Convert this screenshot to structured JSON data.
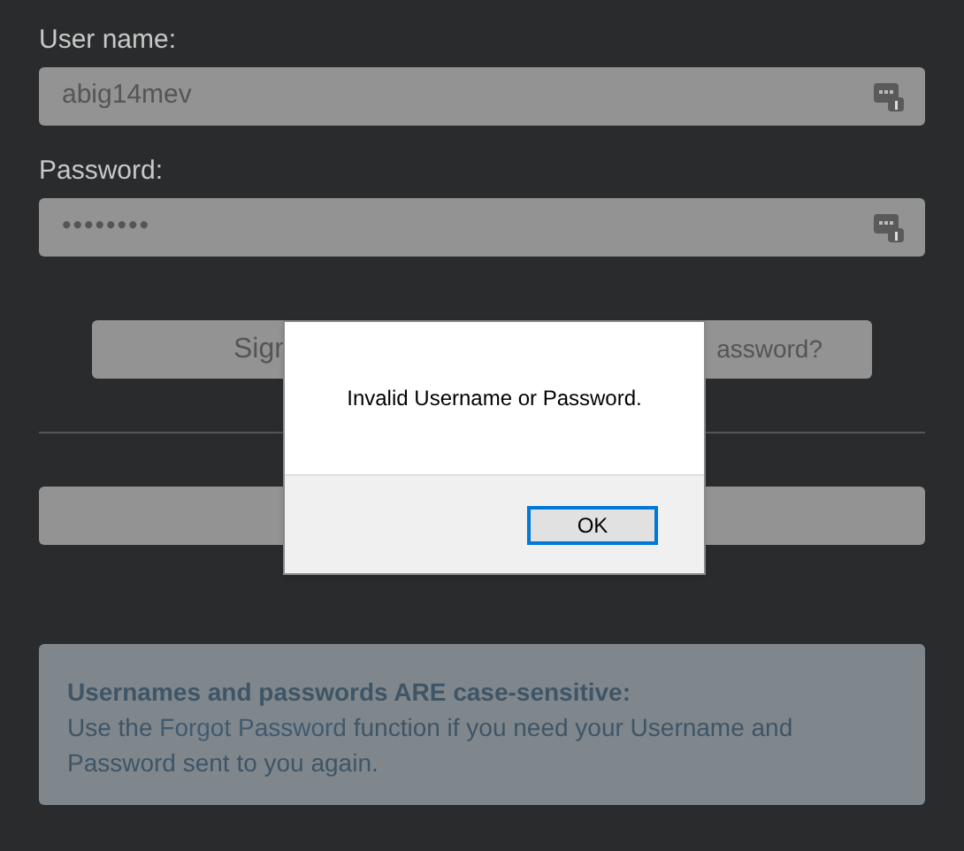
{
  "form": {
    "fields": [
      {
        "label": "User name:",
        "value": "abig14mev",
        "kind": "text"
      },
      {
        "label": "Password:",
        "value": "••••••••",
        "kind": "password"
      }
    ],
    "buttons": [
      {
        "label": "Sign"
      },
      {
        "label": "assword?"
      }
    ]
  },
  "notice": {
    "heading": "Usernames and passwords ARE case-sensitive:",
    "text_before": "Use the ",
    "link": "Forgot Password",
    "text_after": " function if you need your Username and Password sent to you again."
  },
  "dialog": {
    "message": "Invalid Username or Password.",
    "button": "OK"
  }
}
